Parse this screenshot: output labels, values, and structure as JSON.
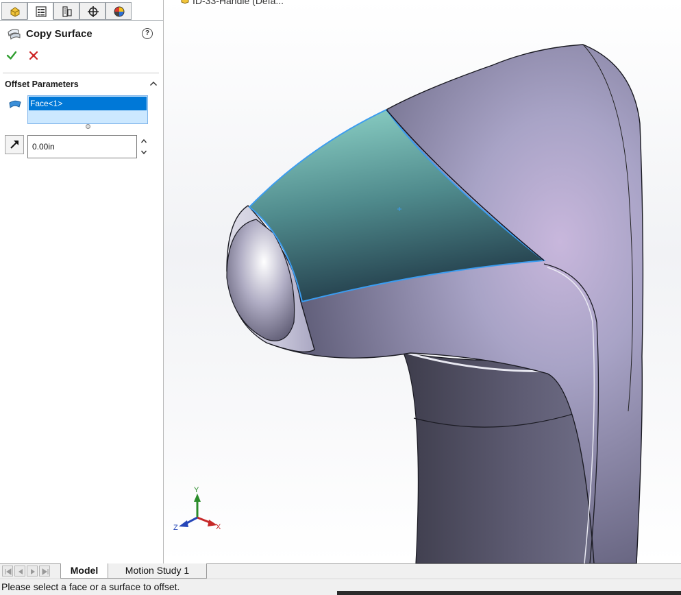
{
  "colors": {
    "accent": "#0078d7",
    "ok_green": "#2f9e2f",
    "cancel_red": "#cc2222",
    "face_highlight": "#6fb7b3",
    "edge_highlight": "#3b9cf0",
    "body_lavender": "#b7b4d2"
  },
  "property_manager": {
    "tabs": [
      {
        "icon": "feature-manager-icon"
      },
      {
        "icon": "property-manager-icon",
        "active": true
      },
      {
        "icon": "configuration-manager-icon"
      },
      {
        "icon": "dimxpert-icon"
      },
      {
        "icon": "display-manager-icon"
      }
    ],
    "title": "Copy Surface",
    "help_label": "?",
    "group": {
      "title": "Offset Parameters",
      "selections": [
        "Face<1>"
      ],
      "distance": "0.00in"
    }
  },
  "viewport": {
    "tree_title": "ID-33-Handle (Defa...",
    "triad": {
      "x_label": "X",
      "y_label": "Y",
      "z_label": "Z"
    }
  },
  "bottom_tabs": {
    "model": "Model",
    "motion": "Motion Study 1"
  },
  "status": {
    "message": "Please select a face or a surface to offset."
  }
}
